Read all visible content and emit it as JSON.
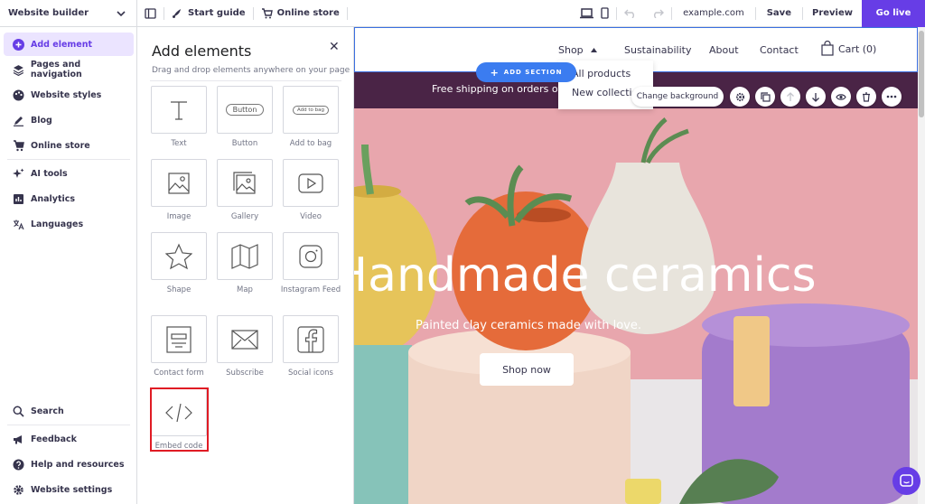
{
  "topbar": {
    "brand_label": "Website builder",
    "start_guide": "Start guide",
    "online_store": "Online store",
    "domain": "example.com",
    "save": "Save",
    "preview": "Preview",
    "go_live": "Go live"
  },
  "sidebar": {
    "items": [
      {
        "label": "Add element",
        "icon": "plus-circle-icon"
      },
      {
        "label": "Pages and navigation",
        "icon": "layers-icon"
      },
      {
        "label": "Website styles",
        "icon": "palette-icon"
      },
      {
        "label": "Blog",
        "icon": "pen-icon"
      },
      {
        "label": "Online store",
        "icon": "cart-icon"
      },
      {
        "label": "AI tools",
        "icon": "sparkle-icon"
      },
      {
        "label": "Analytics",
        "icon": "chart-icon"
      },
      {
        "label": "Languages",
        "icon": "translate-icon"
      }
    ],
    "bottom_items": [
      {
        "label": "Search",
        "icon": "search-icon"
      },
      {
        "label": "Feedback",
        "icon": "megaphone-icon"
      },
      {
        "label": "Help and resources",
        "icon": "help-icon"
      },
      {
        "label": "Website settings",
        "icon": "gear-icon"
      }
    ]
  },
  "panel": {
    "title": "Add elements",
    "subtitle": "Drag and drop elements anywhere on your page",
    "elements": [
      {
        "label": "Text",
        "icon": "text-icon"
      },
      {
        "label": "Button",
        "icon": "button-icon",
        "preview_text": "Button"
      },
      {
        "label": "Add to bag",
        "icon": "add-to-bag-icon",
        "preview_text": "Add to bag"
      },
      {
        "label": "Image",
        "icon": "image-icon"
      },
      {
        "label": "Gallery",
        "icon": "gallery-icon"
      },
      {
        "label": "Video",
        "icon": "video-icon"
      },
      {
        "label": "Shape",
        "icon": "star-icon"
      },
      {
        "label": "Map",
        "icon": "map-icon"
      },
      {
        "label": "Instagram Feed",
        "icon": "instagram-icon"
      },
      {
        "label": "Contact form",
        "icon": "form-icon"
      },
      {
        "label": "Subscribe",
        "icon": "envelope-icon"
      },
      {
        "label": "Social icons",
        "icon": "facebook-icon"
      },
      {
        "label": "Embed code",
        "icon": "code-icon"
      }
    ]
  },
  "site": {
    "nav": {
      "shop": "Shop",
      "sustainability": "Sustainability",
      "about": "About",
      "contact": "Contact",
      "cart": "Cart (0)"
    },
    "dropdown": [
      "All products",
      "New collection"
    ],
    "promo": "Free shipping on orders over",
    "hero_title": "Handmade ceramics",
    "hero_sub": "Painted clay ceramics made with love.",
    "hero_button": "Shop now",
    "add_section": "ADD SECTION",
    "change_background": "Change background"
  },
  "colors": {
    "accent": "#673de6",
    "selection_blue": "#3b6fe0",
    "promo_bg": "#4a2446",
    "hero_bg": "#e8a6ad",
    "highlight_red": "#e01b24"
  }
}
